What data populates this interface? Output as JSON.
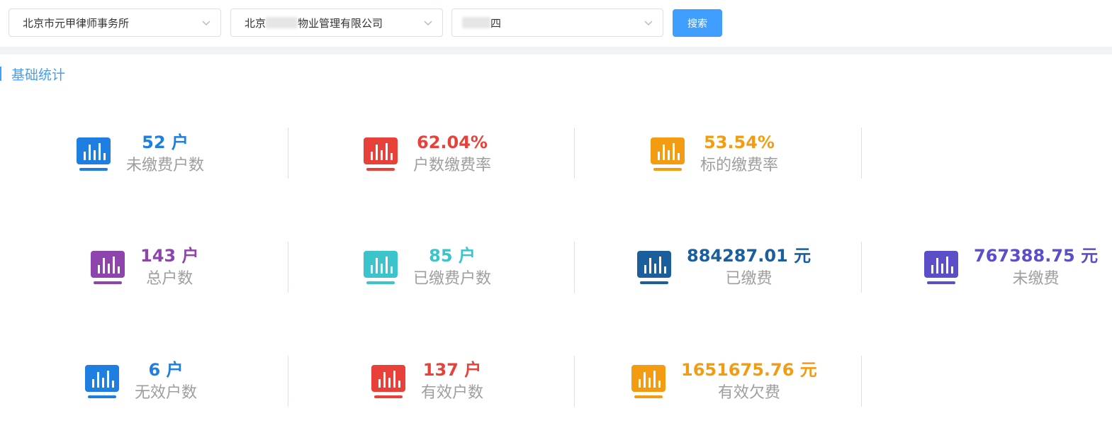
{
  "filters": {
    "firm": "北京市元甲律师事务所",
    "company_prefix": "北京",
    "company_suffix": "物业管理有限公司",
    "project_suffix": "四",
    "search_label": "搜索"
  },
  "section": {
    "title": "基础统计"
  },
  "colors": {
    "blue": "#1e7fe0",
    "red": "#e8413a",
    "orange": "#f39c12",
    "purple": "#8e44ad",
    "teal": "#3cc4cc",
    "navy": "#1a5e9c",
    "indigo": "#5b4fc9",
    "accent": "#409eff"
  },
  "stats": [
    {
      "value": "52 户",
      "label": "未缴费户数",
      "color": "#1e7fe0",
      "icon": "bar-chart-icon"
    },
    {
      "value": "62.04%",
      "label": "户数缴费率",
      "color": "#e8413a",
      "icon": "bar-chart-icon"
    },
    {
      "value": "53.54%",
      "label": "标的缴费率",
      "color": "#f39c12",
      "icon": "bar-chart-icon"
    },
    {
      "value": "143 户",
      "label": "总户数",
      "color": "#8e44ad",
      "icon": "bar-chart-icon"
    },
    {
      "value": "85 户",
      "label": "已缴费户数",
      "color": "#3cc4cc",
      "icon": "bar-chart-icon"
    },
    {
      "value": "884287.01 元",
      "label": "已缴费",
      "color": "#1a5e9c",
      "icon": "bar-chart-icon"
    },
    {
      "value": "767388.75 元",
      "label": "未缴费",
      "color": "#5b4fc9",
      "icon": "bar-chart-icon"
    },
    {
      "value": "6 户",
      "label": "无效户数",
      "color": "#1e7fe0",
      "icon": "bar-chart-icon"
    },
    {
      "value": "137 户",
      "label": "有效户数",
      "color": "#e8413a",
      "icon": "bar-chart-icon"
    },
    {
      "value": "1651675.76 元",
      "label": "有效欠费",
      "color": "#f39c12",
      "icon": "bar-chart-icon"
    }
  ]
}
